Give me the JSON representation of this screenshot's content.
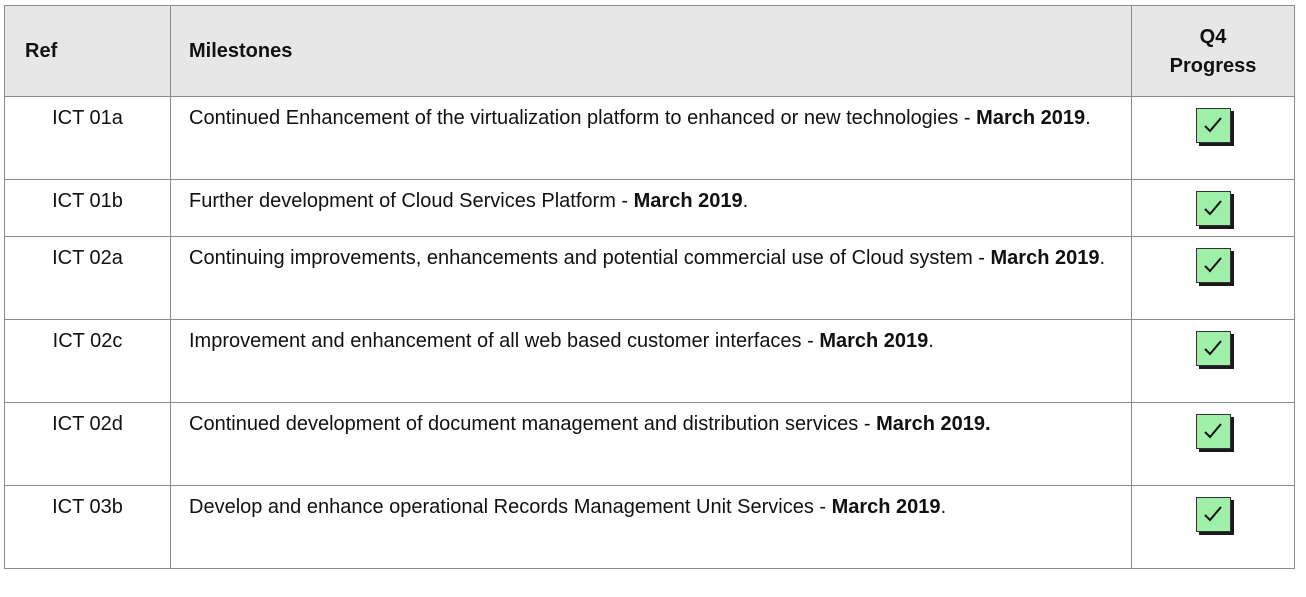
{
  "table": {
    "headers": {
      "ref": "Ref",
      "milestones": "Milestones",
      "progress_line1": "Q4",
      "progress_line2": "Progress"
    },
    "rows": [
      {
        "ref": "ICT 01a",
        "text": "Continued Enhancement of the virtualization platform to enhanced or new technologies - ",
        "date": "March 2019",
        "trail": ".",
        "progress": "complete-check-icon"
      },
      {
        "ref": "ICT 01b",
        "text": "Further development of Cloud Services Platform - ",
        "date": "March 2019",
        "trail": ".",
        "progress": "complete-check-icon"
      },
      {
        "ref": "ICT 02a",
        "text": "Continuing improvements, enhancements and potential commercial use of Cloud system - ",
        "date": "March 2019",
        "trail": ".",
        "progress": "complete-check-icon"
      },
      {
        "ref": "ICT 02c",
        "text": "Improvement and enhancement of all web based customer interfaces - ",
        "date": "March 2019",
        "trail": ".",
        "progress": "complete-check-icon"
      },
      {
        "ref": "ICT 02d",
        "text": "Continued development of document management and distribution services - ",
        "date": "March 2019.",
        "trail": "",
        "progress": "complete-check-icon"
      },
      {
        "ref": "ICT 03b",
        "text": "Develop and enhance operational Records Management Unit Services - ",
        "date": "March 2019",
        "trail": ".",
        "progress": "complete-check-icon"
      }
    ]
  },
  "colors": {
    "header_bg": "#e7e7e7",
    "check_bg": "#9ef0a9",
    "border": "#8a8a8a"
  }
}
